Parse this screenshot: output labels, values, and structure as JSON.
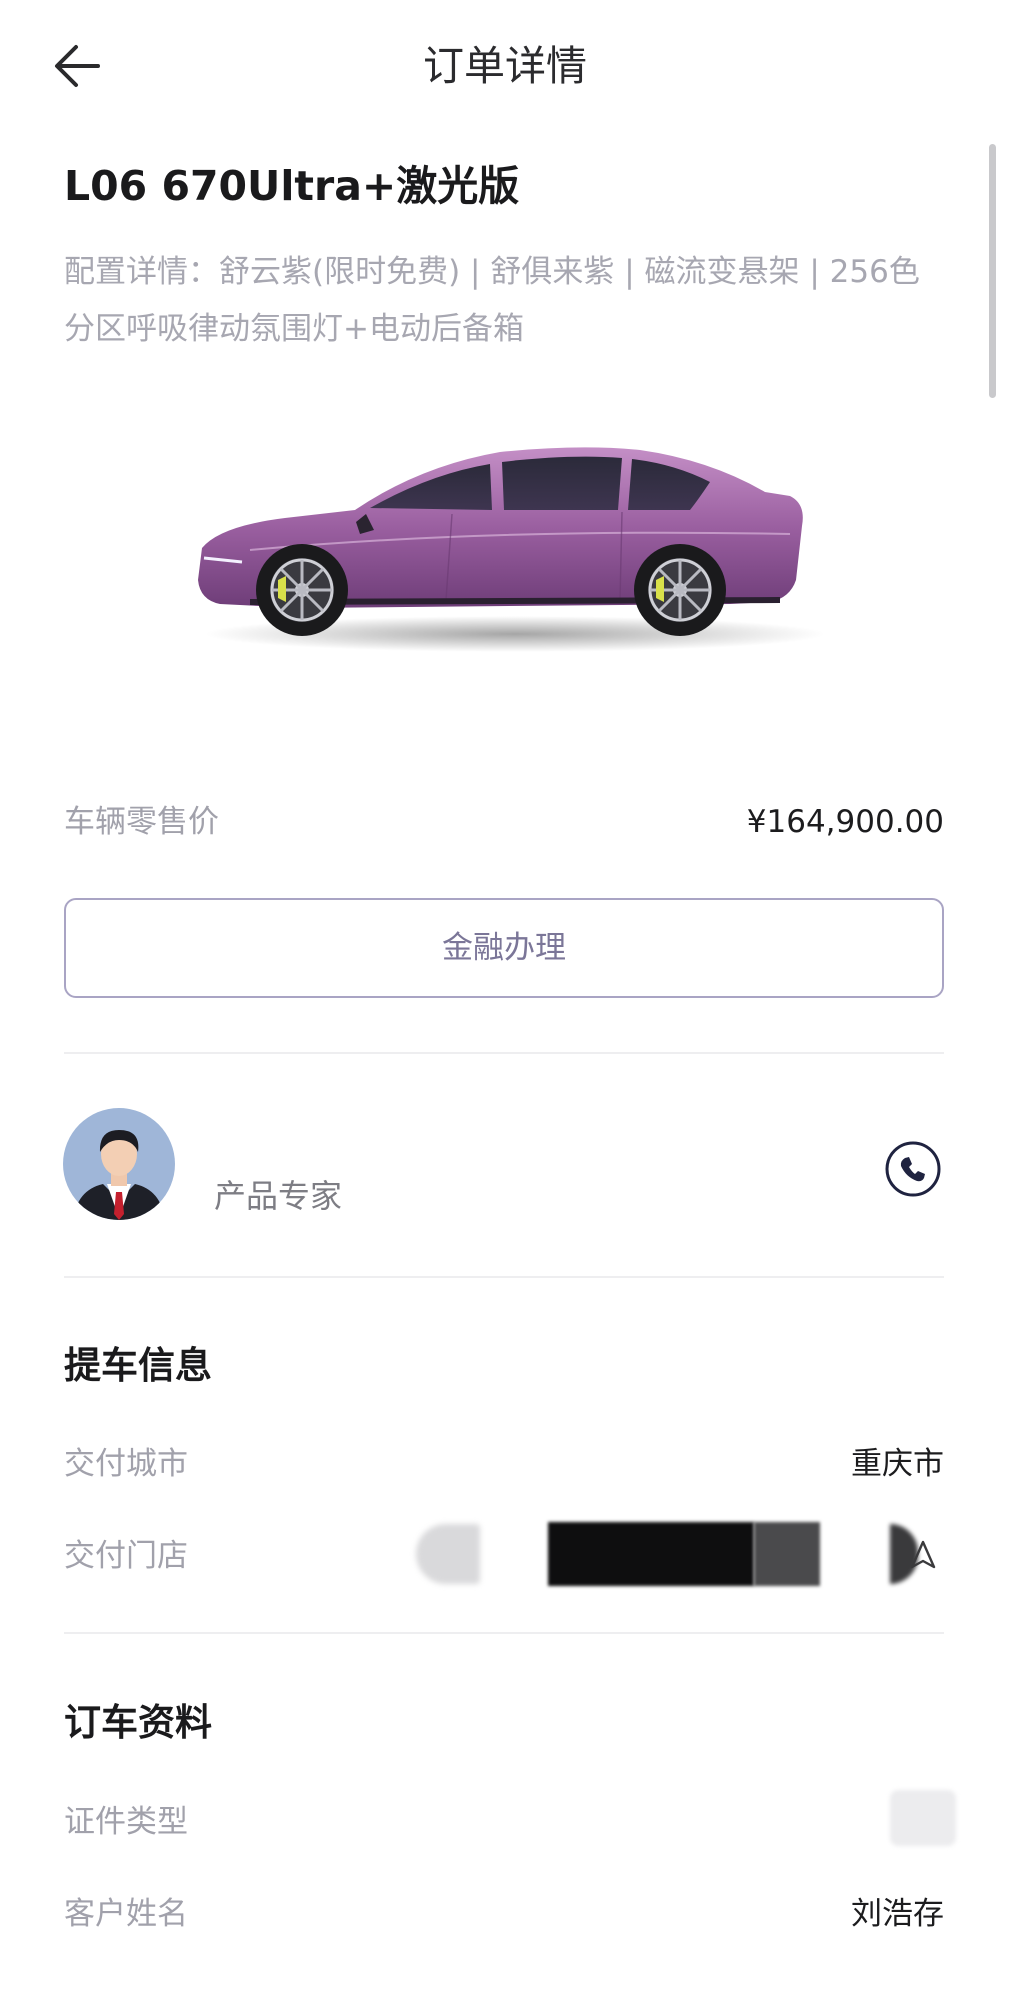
{
  "header": {
    "title": "订单详情"
  },
  "order": {
    "model": "L06 670Ultra+激光版",
    "config": "配置详情：舒云紫(限时免费) | 舒俱来紫 | 磁流变悬架 | 256色分区呼吸律动氛围灯+电动后备箱"
  },
  "car_image": {
    "color": "#9a5fa0",
    "description_icon": "car-side-view"
  },
  "price": {
    "label": "车辆零售价",
    "value": "¥164,900.00"
  },
  "finance_button": {
    "label": "金融办理"
  },
  "expert": {
    "label": "产品专家",
    "avatar_icon": "person-avatar",
    "phone_icon": "phone-icon"
  },
  "pickup": {
    "title": "提车信息",
    "city_label": "交付城市",
    "city_value": "重庆市",
    "store_label": "交付门店"
  },
  "booking": {
    "title": "订车资料",
    "id_type_label": "证件类型",
    "name_label": "客户姓名",
    "name_value": "刘浩存"
  },
  "colors": {
    "accent_border": "#a9a4c4",
    "accent_text": "#7b7698",
    "label_gray": "#a1a1ab",
    "phone_navy": "#1f2340"
  }
}
